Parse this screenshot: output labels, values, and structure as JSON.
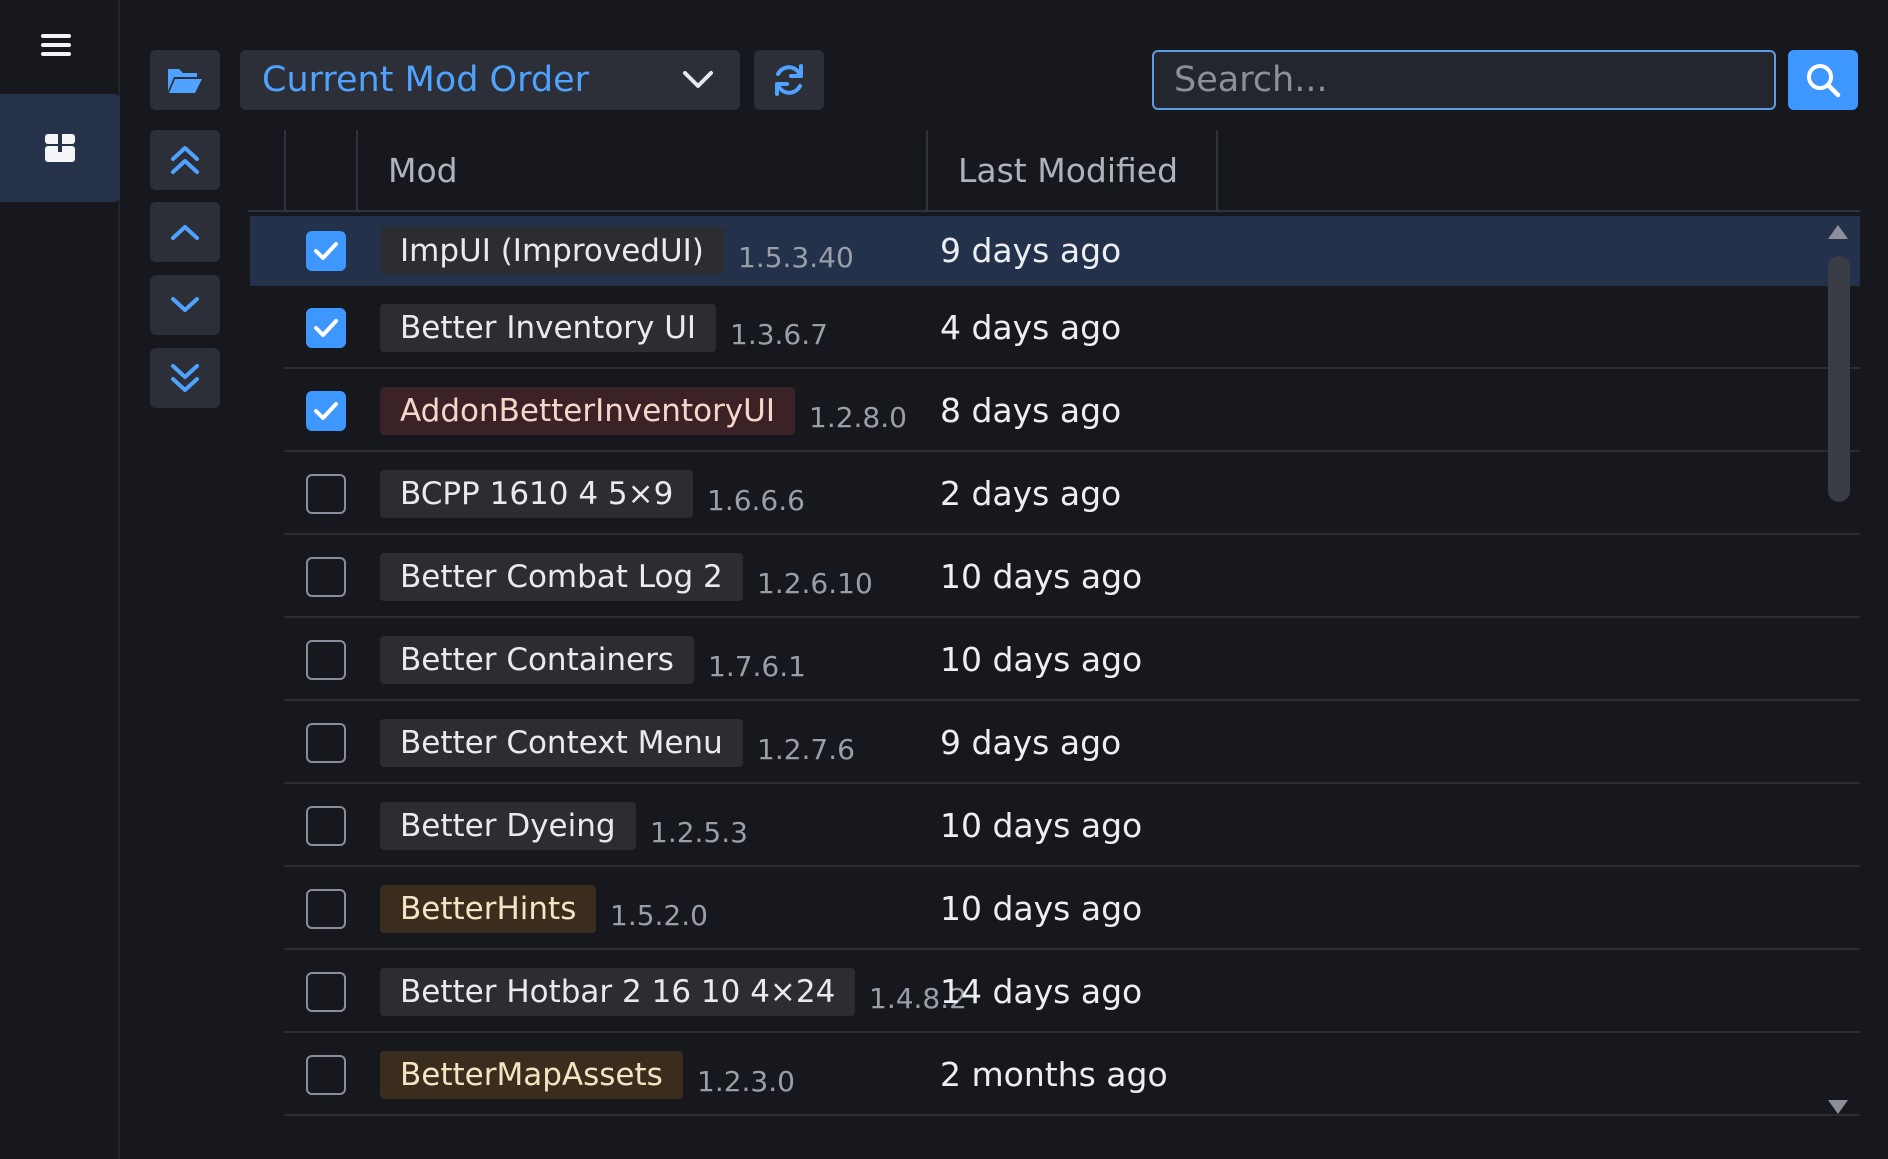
{
  "toolbar": {
    "profile_label": "Current Mod Order",
    "search_placeholder": "Search..."
  },
  "icons": {
    "menu": "hamburger-icon",
    "mods": "package-icon",
    "folder": "folder-open-icon",
    "profile_dropdown": "chevron-down-icon",
    "refresh": "refresh-icon",
    "search": "search-icon",
    "move_top": "double-chevron-up-icon",
    "move_up": "chevron-up-icon",
    "move_down": "chevron-down-icon",
    "move_bottom": "double-chevron-down-icon",
    "checkmark": "checkmark-icon"
  },
  "colors": {
    "accent": "#3d97ff",
    "selected_row": "#23324a",
    "tag_default": "#2b2d33",
    "tag_red": "#3a2226",
    "tag_amber": "#3a2d1e"
  },
  "table": {
    "headers": {
      "mod": "Mod",
      "last_modified": "Last Modified"
    },
    "rows": [
      {
        "name": "ImpUI (ImprovedUI)",
        "version": "1.5.3.40",
        "modified": "9 days ago",
        "checked": true,
        "selected": true,
        "tag": "default"
      },
      {
        "name": "Better Inventory UI",
        "version": "1.3.6.7",
        "modified": "4 days ago",
        "checked": true,
        "selected": false,
        "tag": "default"
      },
      {
        "name": "AddonBetterInventoryUI",
        "version": "1.2.8.0",
        "modified": "8 days ago",
        "checked": true,
        "selected": false,
        "tag": "red"
      },
      {
        "name": "BCPP 1610 4 5×9",
        "version": "1.6.6.6",
        "modified": "2 days ago",
        "checked": false,
        "selected": false,
        "tag": "default"
      },
      {
        "name": "Better Combat Log 2",
        "version": "1.2.6.10",
        "modified": "10 days ago",
        "checked": false,
        "selected": false,
        "tag": "default"
      },
      {
        "name": "Better Containers",
        "version": "1.7.6.1",
        "modified": "10 days ago",
        "checked": false,
        "selected": false,
        "tag": "default"
      },
      {
        "name": "Better Context Menu",
        "version": "1.2.7.6",
        "modified": "9 days ago",
        "checked": false,
        "selected": false,
        "tag": "default"
      },
      {
        "name": "Better Dyeing",
        "version": "1.2.5.3",
        "modified": "10 days ago",
        "checked": false,
        "selected": false,
        "tag": "default"
      },
      {
        "name": "BetterHints",
        "version": "1.5.2.0",
        "modified": "10 days ago",
        "checked": false,
        "selected": false,
        "tag": "amber"
      },
      {
        "name": "Better Hotbar 2 16 10 4×24",
        "version": "1.4.8.2",
        "modified": "14 days ago",
        "checked": false,
        "selected": false,
        "tag": "default"
      },
      {
        "name": "BetterMapAssets",
        "version": "1.2.3.0",
        "modified": "2 months ago",
        "checked": false,
        "selected": false,
        "tag": "amber"
      }
    ]
  }
}
